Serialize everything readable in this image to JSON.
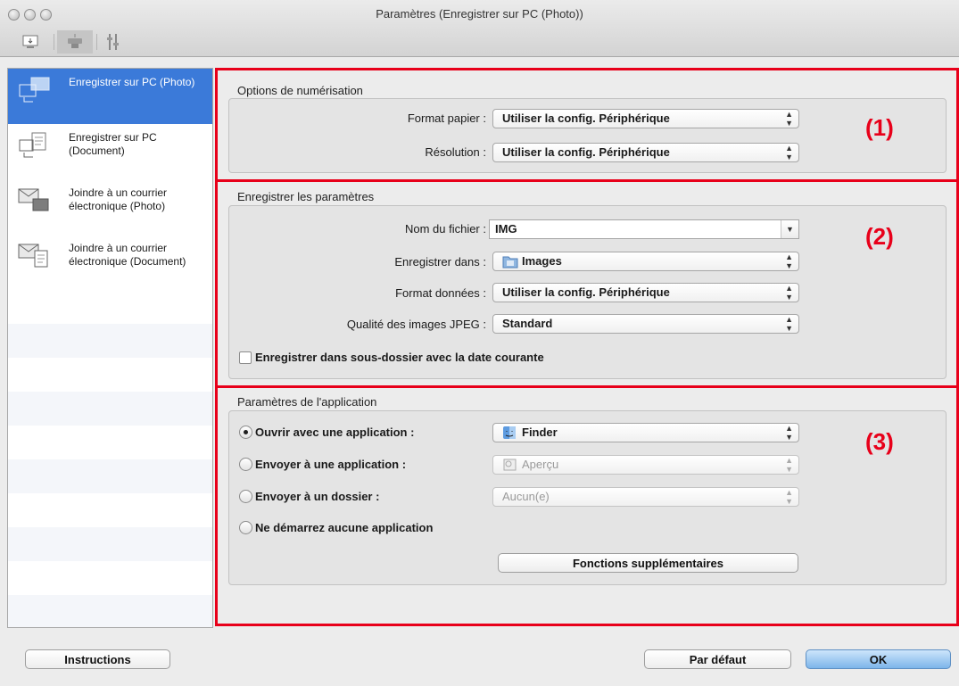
{
  "window": {
    "title": "Paramètres (Enregistrer sur PC (Photo))"
  },
  "toolbar": {
    "icons": [
      "scan-from-computer-icon",
      "scan-from-panel-icon",
      "general-settings-icon"
    ]
  },
  "sidebar": {
    "items": [
      {
        "label": "Enregistrer sur PC (Photo)",
        "icon": "save-photo-icon",
        "selected": true
      },
      {
        "label": "Enregistrer sur PC (Document)",
        "icon": "save-document-icon",
        "selected": false
      },
      {
        "label": "Joindre à un courrier électronique (Photo)",
        "icon": "mail-photo-icon",
        "selected": false
      },
      {
        "label": "Joindre à un courrier électronique (Document)",
        "icon": "mail-document-icon",
        "selected": false
      }
    ]
  },
  "scan_options": {
    "title": "Options de numérisation",
    "number": "(1)",
    "paper_size": {
      "label": "Format papier :",
      "value": "Utiliser la config. Périphérique"
    },
    "resolution": {
      "label": "Résolution :",
      "value": "Utiliser la config. Périphérique"
    }
  },
  "save_settings": {
    "title": "Enregistrer les paramètres",
    "number": "(2)",
    "file_name": {
      "label": "Nom du fichier :",
      "value": "IMG"
    },
    "save_in": {
      "label": "Enregistrer dans :",
      "value": "Images"
    },
    "data_format": {
      "label": "Format données :",
      "value": "Utiliser la config. Périphérique"
    },
    "jpeg_quality": {
      "label": "Qualité des images JPEG :",
      "value": "Standard"
    },
    "subfolder": {
      "label": "Enregistrer dans sous-dossier avec la date courante",
      "checked": false
    }
  },
  "app_settings": {
    "title": "Paramètres de l'application",
    "number": "(3)",
    "open_app": {
      "label": "Ouvrir avec une application :",
      "value": "Finder",
      "selected": true
    },
    "send_app": {
      "label": "Envoyer à une application :",
      "value": "Aperçu",
      "selected": false
    },
    "send_folder": {
      "label": "Envoyer à un dossier :",
      "value": "Aucun(e)",
      "selected": false
    },
    "no_app": {
      "label": "Ne démarrez aucune application",
      "selected": false
    },
    "more_functions": "Fonctions supplémentaires"
  },
  "footer": {
    "instructions": "Instructions",
    "defaults": "Par défaut",
    "ok": "OK"
  },
  "colors": {
    "highlight": "#e8001a",
    "selection": "#3b7ad9"
  }
}
